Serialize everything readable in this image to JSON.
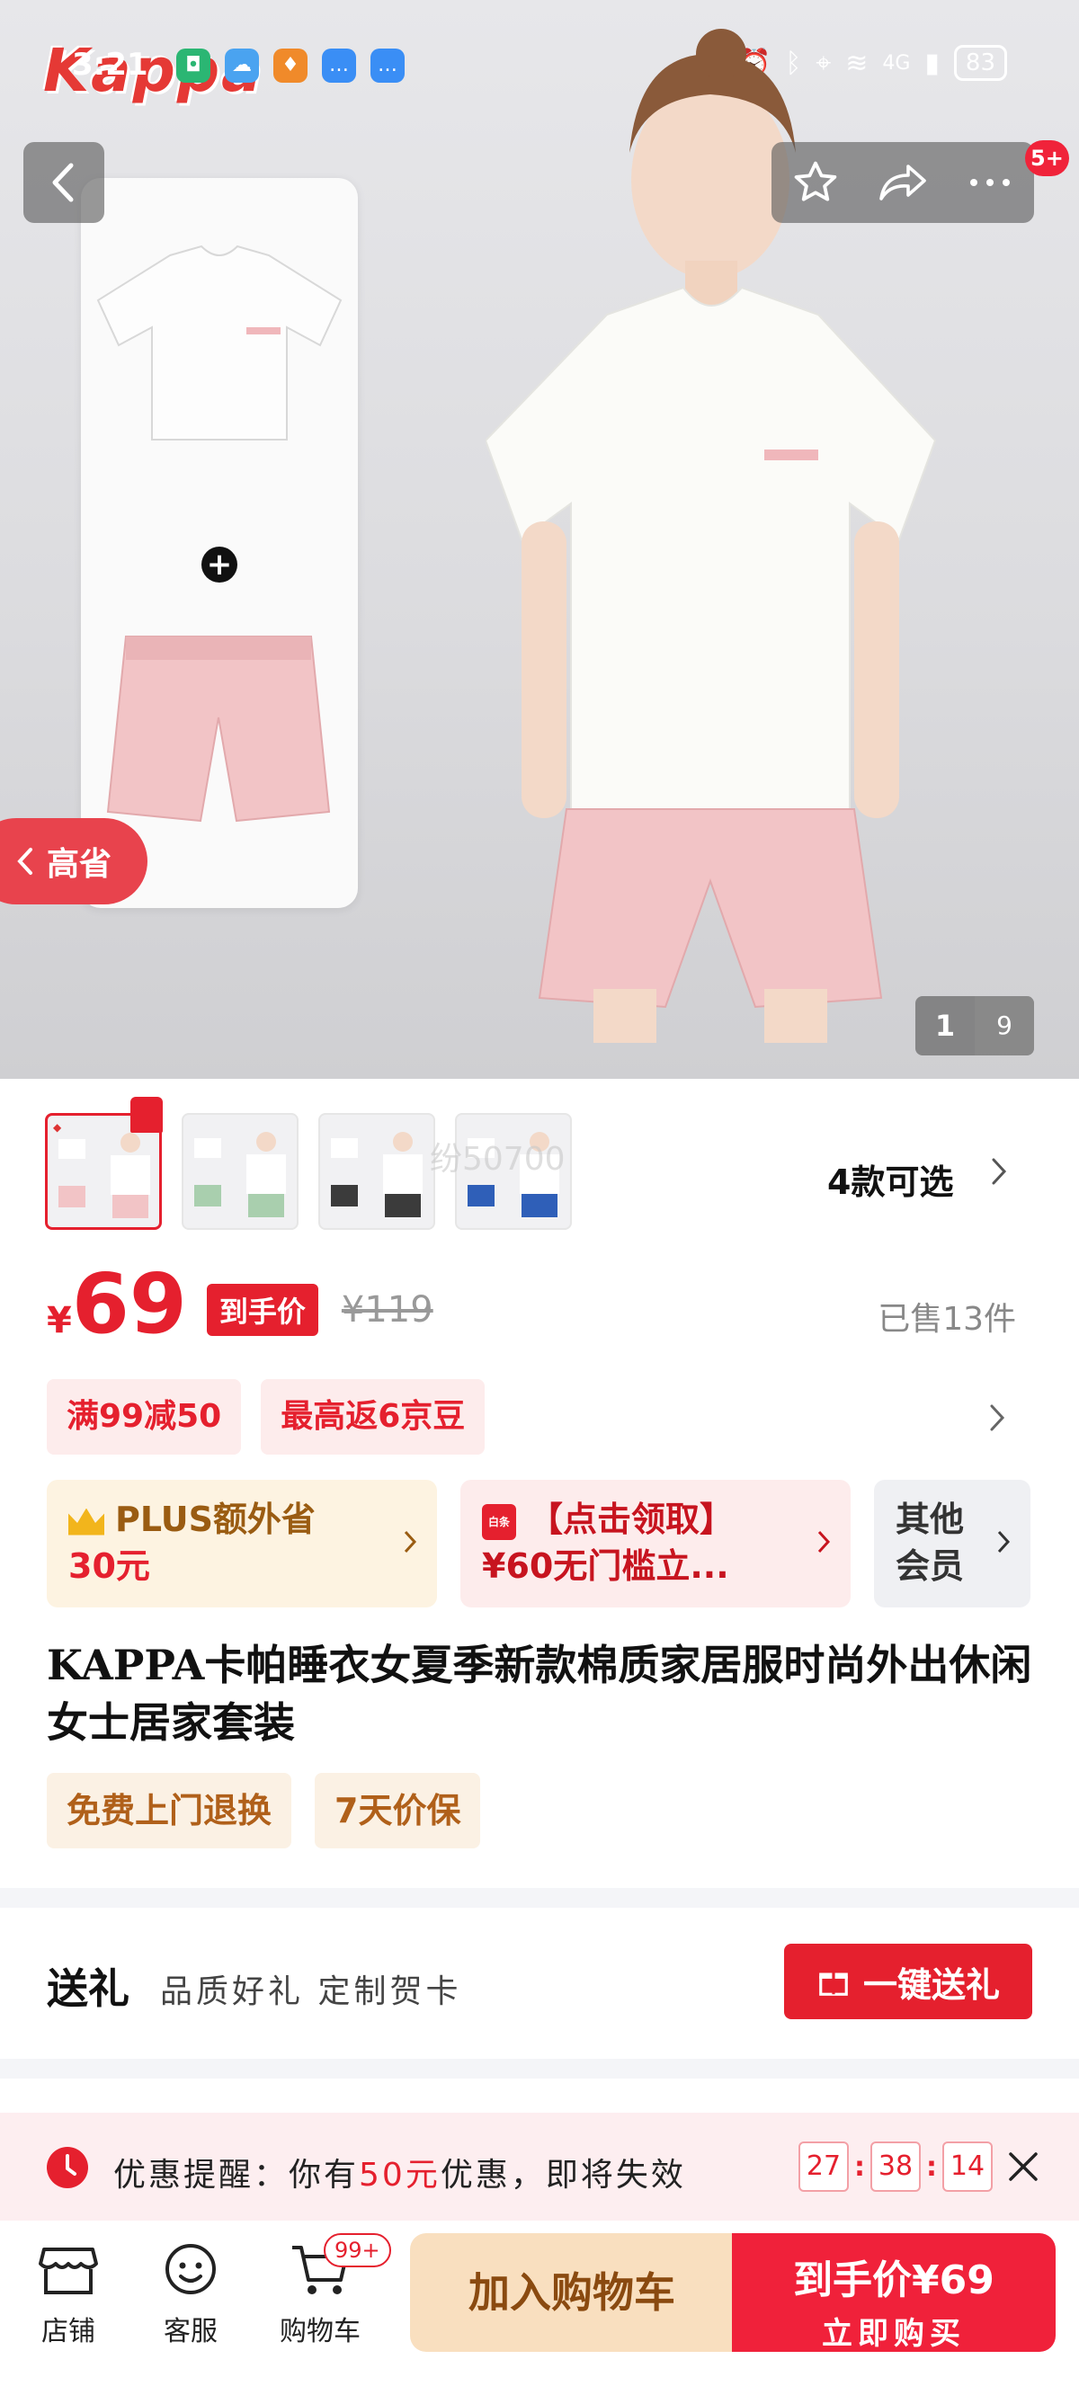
{
  "status_bar": {
    "time": "3:21",
    "battery": "83",
    "network": "4G"
  },
  "hero": {
    "brand": "Kappa",
    "notification_badge": "5+",
    "side_tab_label": "高省",
    "page_current": "1",
    "page_total": "9"
  },
  "variants": {
    "count_label": "4款可选",
    "watermark": "纷50700"
  },
  "price": {
    "currency": "¥",
    "amount": "69",
    "deal_tag": "到手价",
    "original": "¥119",
    "sold": "已售13件"
  },
  "promotions": [
    "满99减50",
    "最高返6京豆"
  ],
  "benefits": {
    "plus_line1": "PLUS额外省",
    "plus_line2": "30元",
    "coupon_icon": "白条",
    "coupon_line1": "【点击领取】",
    "coupon_line2": "¥60无门槛立...",
    "other_line1": "其他",
    "other_line2": "会员"
  },
  "product_title": "KAPPA卡帕睡衣女夏季新款棉质家居服时尚外出休闲女士居家套装",
  "services": [
    "免费上门退换",
    "7天价保"
  ],
  "gift": {
    "title": "送礼",
    "desc": "品质好礼 定制贺卡",
    "button": "一键送礼"
  },
  "reminder": {
    "prefix": "优惠提醒：你有",
    "amount": "50元",
    "suffix": "优惠，即将失效",
    "hours": "27",
    "minutes": "38",
    "seconds": "14"
  },
  "bottom_nav": {
    "store": "店铺",
    "service": "客服",
    "cart": "购物车",
    "cart_badge": "99+",
    "add_to_cart": "加入购物车",
    "buy_price": "到手价¥69",
    "buy_now": "立即购买"
  },
  "colors": {
    "accent_red": "#e5202e",
    "plus_gold": "#9a5c12",
    "add_cart_bg": "#f9dfbf"
  }
}
